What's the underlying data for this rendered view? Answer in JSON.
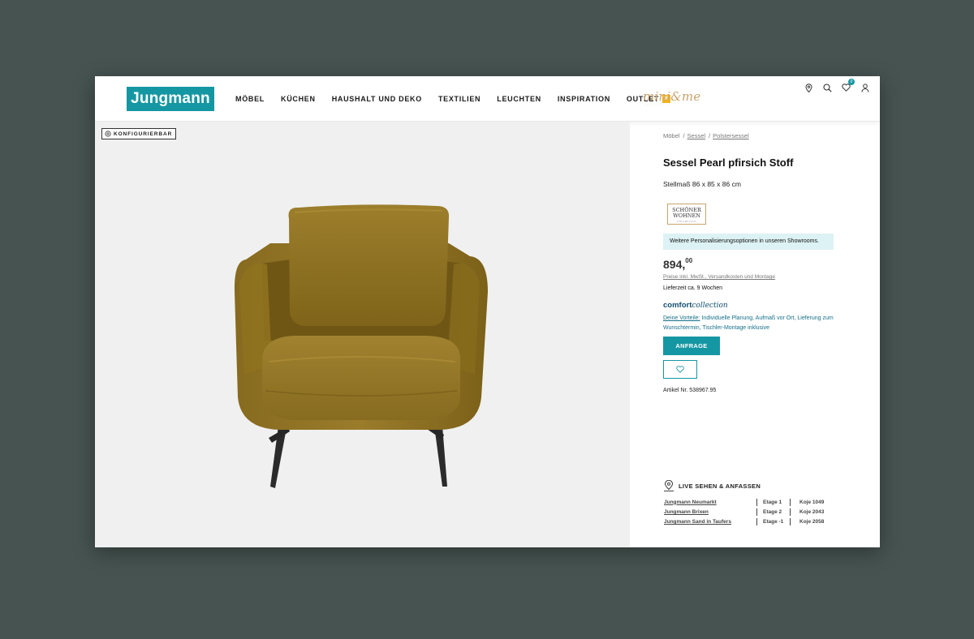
{
  "header": {
    "logo": "Jungmann",
    "nav": [
      {
        "label": "MÖBEL"
      },
      {
        "label": "KÜCHEN"
      },
      {
        "label": "HAUSHALT UND DEKO"
      },
      {
        "label": "TEXTILIEN"
      },
      {
        "label": "LEUCHTEN"
      },
      {
        "label": "INSPIRATION"
      },
      {
        "label": "OUTLET"
      }
    ],
    "outlet_badge": "%",
    "mini_logo": "mini&me",
    "wishlist_count": "0",
    "icons": [
      "location-pin-icon",
      "search-icon",
      "heart-icon",
      "user-icon"
    ]
  },
  "image": {
    "badge": "KONFIGURIERBAR"
  },
  "product": {
    "breadcrumb": [
      "Möbel",
      "Sessel",
      "Polstersessel"
    ],
    "title": "Sessel Pearl pfirsich Stoff",
    "dimensions": "Stellmaß 86 x 85 x 86 cm",
    "brand_logo_line1": "SCHÖNER",
    "brand_logo_line2": "WOHNEN",
    "brand_logo_line3": "KOLLEKTION",
    "info": "Weitere Personalisierungsoptionen in unseren Showrooms.",
    "price_main": "894,",
    "price_cents": "00",
    "price_note": "Preise inkl. MwSt., Versandkosten und Montage",
    "delivery": "Lieferzeit ca. 9 Wochen",
    "cc_bold": "comfort",
    "cc_italic": "collection",
    "vorteile_link": "Deine Vorteile:",
    "vorteile_text": "Individuelle Planung, Aufmaß vor Ort, Lieferung zum Wunschtermin, Tischler-Montage inklusive",
    "anfrage_label": "ANFRAGE",
    "artikel": "Artikel Nr. 538967.95"
  },
  "live": {
    "heading": "LIVE SEHEN & ANFASSEN",
    "stores": [
      {
        "name": "Jungmann Neumarkt",
        "etage": "Etage 1",
        "koje": "Koje 1049"
      },
      {
        "name": "Jungmann Brixen",
        "etage": "Etage 2",
        "koje": "Koje 2043"
      },
      {
        "name": "Jungmann Sand in Taufers",
        "etage": "Etage -1",
        "koje": "Koje 2058"
      }
    ]
  },
  "colors": {
    "accent": "#1597a3",
    "outlet": "#f3b21b",
    "mini": "#c9a36a",
    "chair": "#8c6f1f"
  }
}
